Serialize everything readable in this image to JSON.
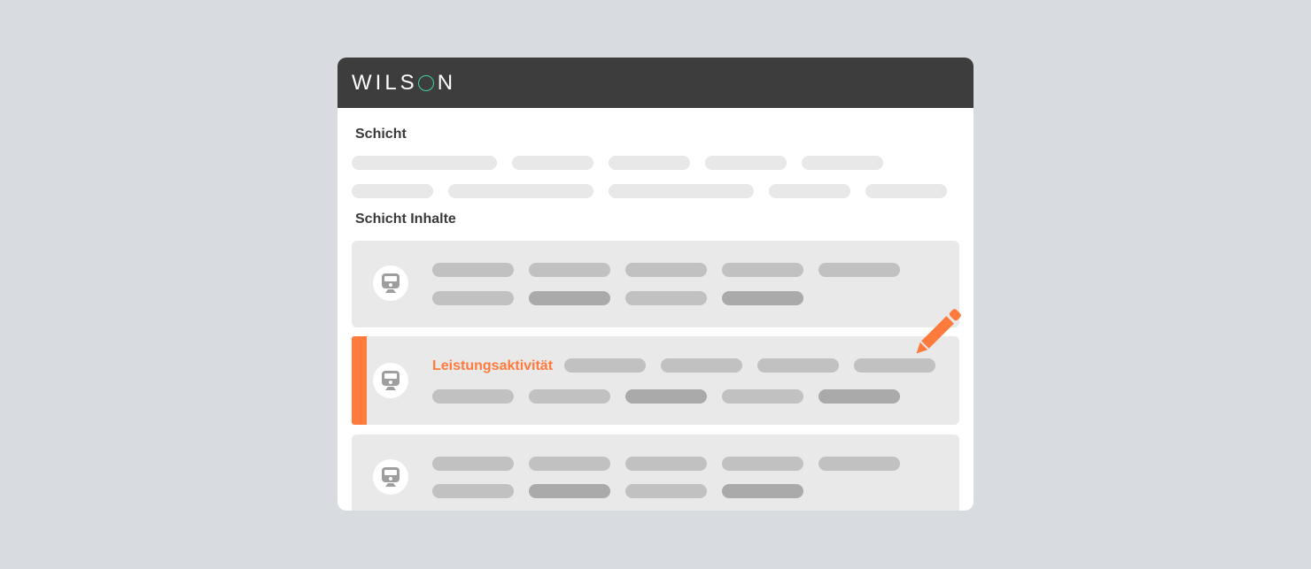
{
  "header": {
    "brand": "WILSON",
    "brand_prefix": "WILS",
    "brand_suffix": "N"
  },
  "sections": {
    "shift": {
      "title": "Schicht"
    },
    "contents": {
      "title": "Schicht Inhalte"
    }
  },
  "cards": [
    {
      "label": "",
      "icon": "train-icon",
      "selected": false
    },
    {
      "label": "Leistungsaktivität",
      "icon": "train-icon",
      "selected": true
    },
    {
      "label": "",
      "icon": "train-icon",
      "selected": false
    }
  ],
  "colors": {
    "accent": "#ff7a3d",
    "header_bg": "#3d3d3d",
    "logo_ring": "#3fd29a",
    "background": "#d8dce0"
  },
  "icons": {
    "edit": "pencil-icon",
    "vehicle": "train-icon"
  }
}
